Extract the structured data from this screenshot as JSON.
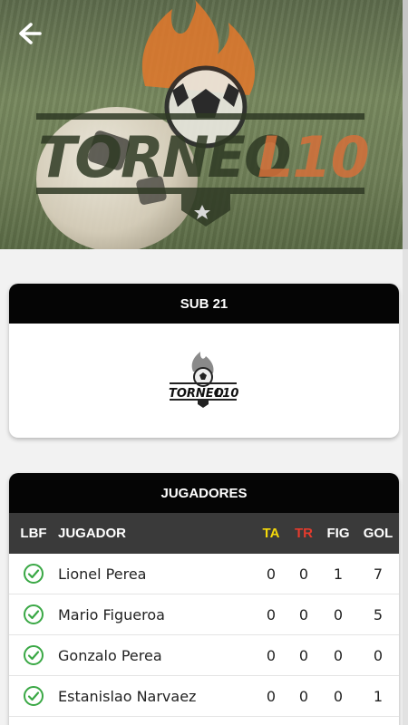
{
  "colors": {
    "header_bg": "#050505",
    "table_header_bg": "#3a3a3a",
    "ta_color": "#f5d90a",
    "tr_color": "#e53b2d",
    "check_color": "#3aa845",
    "accent_flame": "#e3782c"
  },
  "hero": {
    "logo_text_left": "TORNEO",
    "logo_text_right": "L10"
  },
  "category": {
    "title": "SUB 21",
    "logo_text_left": "TORNEO",
    "logo_text_right": "L10"
  },
  "players": {
    "title": "JUGADORES",
    "columns": {
      "lbf": "LBF",
      "jugador": "JUGADOR",
      "ta": "TA",
      "tr": "TR",
      "fig": "FIG",
      "gol": "GOL"
    },
    "rows": [
      {
        "name": "Lionel Perea",
        "ta": "0",
        "tr": "0",
        "fig": "1",
        "gol": "7",
        "lbf_icon": "check-circle-icon"
      },
      {
        "name": "Mario Figueroa",
        "ta": "0",
        "tr": "0",
        "fig": "0",
        "gol": "5",
        "lbf_icon": "check-circle-icon"
      },
      {
        "name": "Gonzalo Perea",
        "ta": "0",
        "tr": "0",
        "fig": "0",
        "gol": "0",
        "lbf_icon": "check-circle-icon"
      },
      {
        "name": "Estanislao Narvaez",
        "ta": "0",
        "tr": "0",
        "fig": "0",
        "gol": "1",
        "lbf_icon": "check-circle-icon"
      }
    ]
  }
}
